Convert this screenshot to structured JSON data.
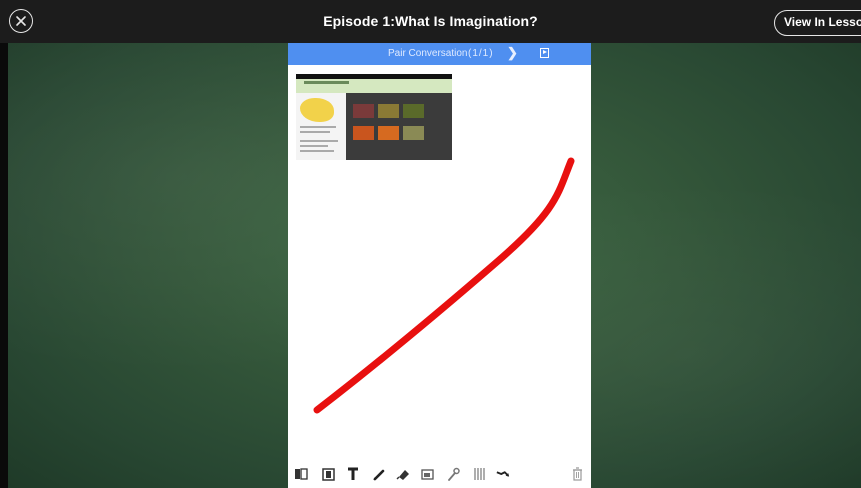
{
  "window": {
    "title": "Episode 1:What Is Imagination?",
    "view_button_label": "View In Lesson"
  },
  "panel": {
    "header_label": "Pair Conversation",
    "page_count": "(1/1)"
  },
  "colors": {
    "accent_blue": "#4f8ff0",
    "pen_red": "#e8100f",
    "board_green": "#34573a"
  },
  "toolbar": {
    "tools": [
      "book-icon",
      "frame-icon",
      "text-icon",
      "pencil-icon",
      "eraser-icon",
      "image-icon",
      "wrench-icon",
      "grid-icon",
      "move-icon",
      "trash-icon"
    ]
  }
}
